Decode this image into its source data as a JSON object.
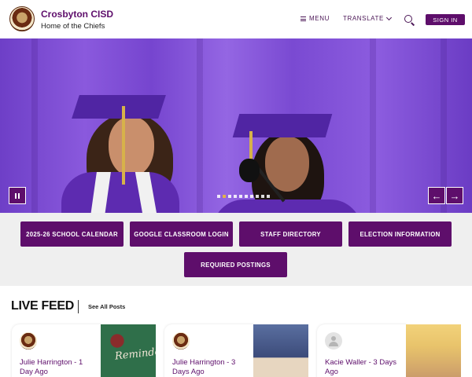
{
  "header": {
    "site_title": "Crosbyton CISD",
    "site_subtitle": "Home of the Chiefs",
    "menu_label": "MENU",
    "translate_label": "TRANSLATE",
    "signin_label": "SIGN IN"
  },
  "hero": {
    "pause_label": "II",
    "prev_label": "←",
    "next_label": "→",
    "slide_count": 10,
    "active_slide": 2
  },
  "quick_links": [
    "2025-26 SCHOOL CALENDAR",
    "GOOGLE CLASSROOM LOGIN",
    "STAFF DIRECTORY",
    "ELECTION INFORMATION",
    "REQUIRED POSTINGS"
  ],
  "live_feed": {
    "title": "LIVE FEED",
    "see_all": "See All Posts",
    "posts": [
      {
        "author": "Julie Harrington - 1 Day Ago",
        "image_text": "Reminder:"
      },
      {
        "author": "Julie Harrington - 3 Days Ago",
        "image_text": ""
      },
      {
        "author": "Kacie Waller - 3 Days Ago",
        "image_text": ""
      }
    ]
  },
  "colors": {
    "brand_purple": "#5e0e6b",
    "accent_gold": "#e2b04a"
  }
}
